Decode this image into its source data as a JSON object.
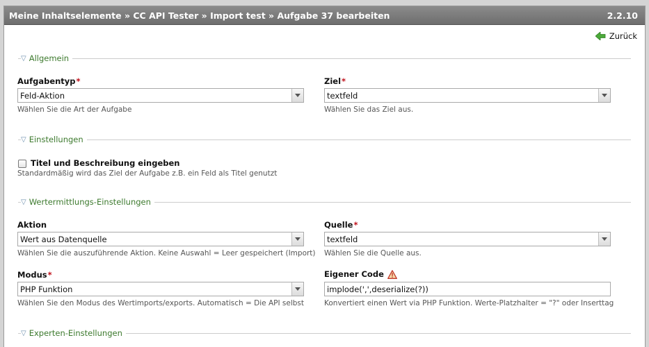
{
  "header": {
    "breadcrumb": "Meine Inhaltselemente » CC API Tester » Import test » Aufgabe 37 bearbeiten",
    "version": "2.2.10"
  },
  "back": {
    "label": "Zurück"
  },
  "sections": {
    "allgemein": "Allgemein",
    "einstellungen": "Einstellungen",
    "wertermittlung": "Wertermittlungs-Einstellungen",
    "experten": "Experten-Einstellungen"
  },
  "fields": {
    "aufgabentyp": {
      "label": "Aufgabentyp",
      "required": "*",
      "value": "Feld-Aktion",
      "help": "Wählen Sie die Art der Aufgabe"
    },
    "ziel": {
      "label": "Ziel",
      "required": "*",
      "value": "textfeld",
      "help": "Wählen Sie das Ziel aus."
    },
    "titel": {
      "label": "Titel und Beschreibung eingeben",
      "checked": false,
      "help": "Standardmäßig wird das Ziel der Aufgabe z.B. ein Feld als Titel genutzt"
    },
    "aktion": {
      "label": "Aktion",
      "value": "Wert aus Datenquelle",
      "help": "Wählen Sie die auszuführende Aktion. Keine Auswahl = Leer gespeichert (Import)"
    },
    "quelle": {
      "label": "Quelle",
      "required": "*",
      "value": "textfeld",
      "help": "Wählen Sie die Quelle aus."
    },
    "modus": {
      "label": "Modus",
      "required": "*",
      "value": "PHP Funktion",
      "help": "Wählen Sie den Modus des Wertimports/exports. Automatisch = Die API selbst"
    },
    "eigener_code": {
      "label": "Eigener Code",
      "value": "implode(',',deserialize(?))",
      "help": "Konvertiert einen Wert via PHP Funktion. Werte-Platzhalter = \"?\" oder Inserttag",
      "icon": "warning-icon"
    }
  },
  "colors": {
    "accent_green": "#3d7a2e",
    "required_red": "#c0101a",
    "titlebar": "#7a7a7a"
  }
}
